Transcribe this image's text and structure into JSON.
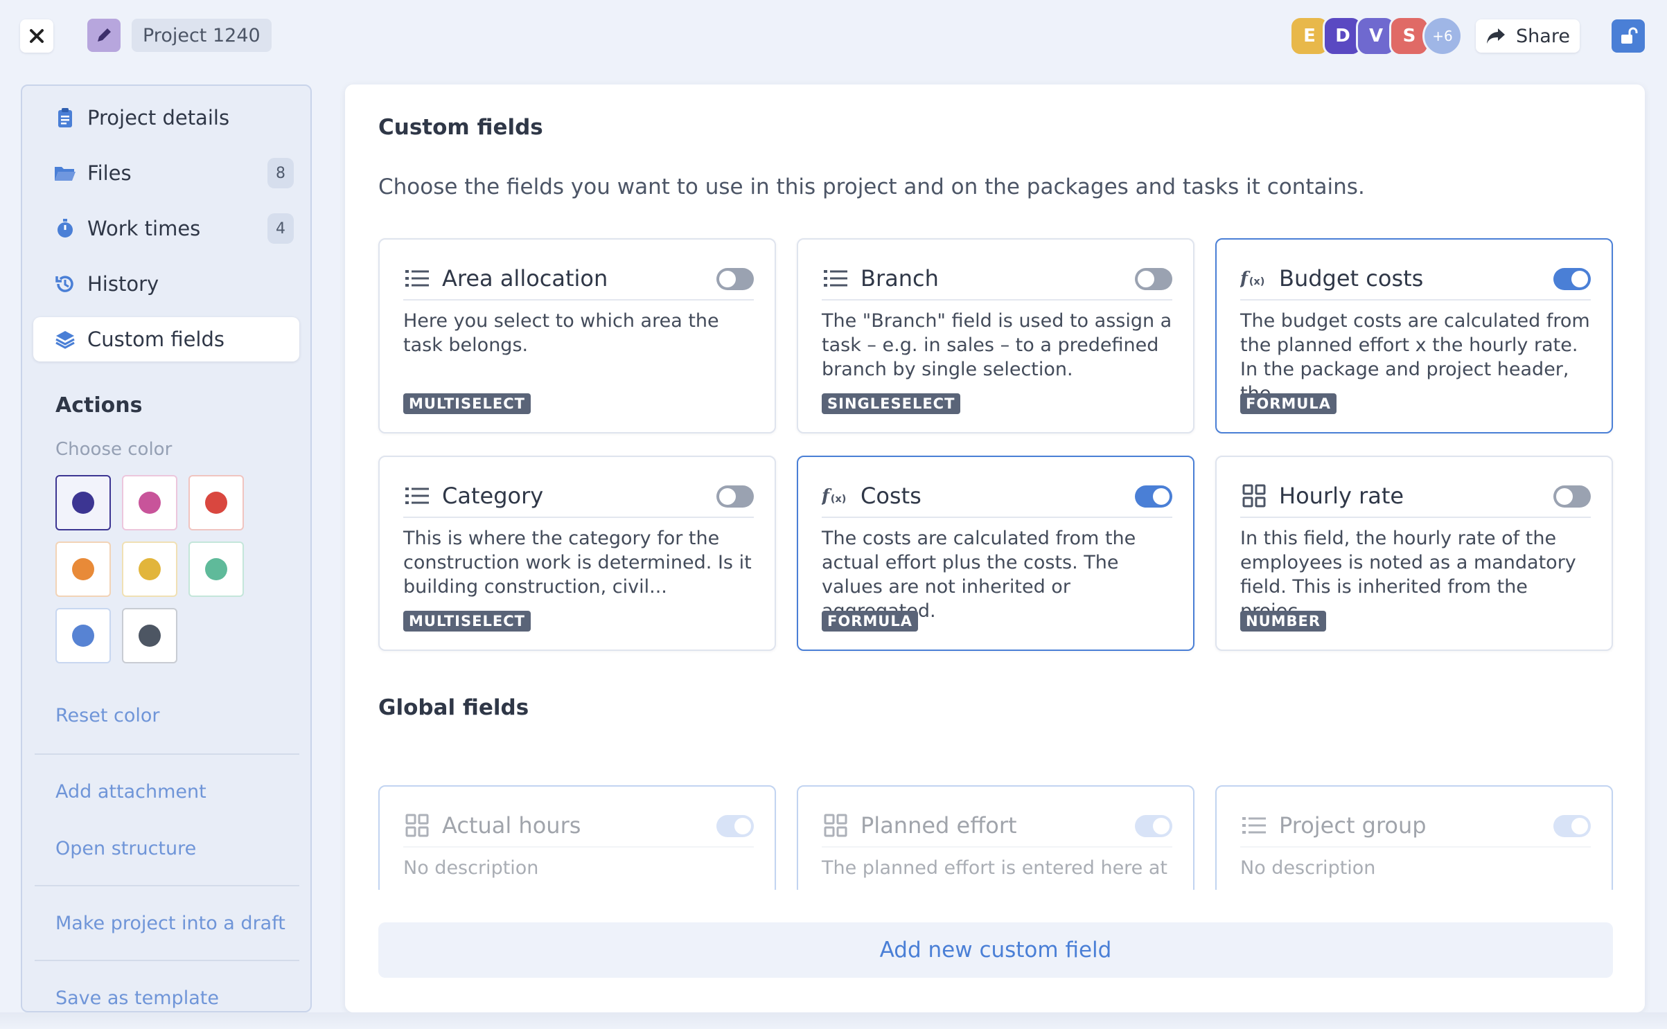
{
  "header": {
    "project_title": "Project 1240",
    "share_label": "Share",
    "avatars": [
      {
        "letter": "E",
        "color": "#e8b84a"
      },
      {
        "letter": "D",
        "color": "#5a49c2"
      },
      {
        "letter": "V",
        "color": "#6f69cf"
      },
      {
        "letter": "S",
        "color": "#e06a66"
      },
      {
        "letter": "+6",
        "color": "#9fb6e6"
      }
    ]
  },
  "sidebar": {
    "items": [
      {
        "label": "Project details"
      },
      {
        "label": "Files",
        "badge": "8"
      },
      {
        "label": "Work times",
        "badge": "4"
      },
      {
        "label": "History"
      },
      {
        "label": "Custom fields"
      }
    ],
    "actions_title": "Actions",
    "choose_color_label": "Choose color",
    "colors": [
      "#3c3592",
      "#c8549a",
      "#d9473f",
      "#e88a38",
      "#e2b53b",
      "#5fba9a",
      "#5783d3",
      "#4d5663"
    ],
    "reset_color": "Reset color",
    "add_attachment": "Add attachment",
    "open_structure": "Open structure",
    "make_draft": "Make project into a draft",
    "save_template": "Save as template"
  },
  "main": {
    "custom_title": "Custom fields",
    "custom_desc": "Choose the fields you want to use in this project and on the packages and tasks it contains.",
    "cards": [
      {
        "title": "Area allocation",
        "desc": "Here you select to which area the task belongs.",
        "tag": "MULTISELECT",
        "icon": "list-icon",
        "on": false
      },
      {
        "title": "Branch",
        "desc": "The \"Branch\" field is used to assign a task – e.g. in sales – to a predefined branch by single selection.",
        "tag": "SINGLESELECT",
        "icon": "list-icon",
        "on": false
      },
      {
        "title": "Budget costs",
        "desc": "The budget costs are calculated from the planned effort x the hourly rate. In the package and project header, the...",
        "tag": "FORMULA",
        "icon": "formula-icon",
        "on": true
      },
      {
        "title": "Category",
        "desc": "This is where the category for the construction work is determined. Is it building construction, civil...",
        "tag": "MULTISELECT",
        "icon": "list-icon",
        "on": false
      },
      {
        "title": "Costs",
        "desc": "The costs are calculated from the actual effort plus the costs. The values are not inherited or aggregated.",
        "tag": "FORMULA",
        "icon": "formula-icon",
        "on": true
      },
      {
        "title": "Hourly rate",
        "desc": "In this field, the hourly rate of the employees is noted as a mandatory field. This is inherited from the projec...",
        "tag": "NUMBER",
        "icon": "number-icon",
        "on": false
      }
    ],
    "global_title": "Global fields",
    "global_cards": [
      {
        "title": "Actual hours",
        "desc": "No description",
        "icon": "number-icon"
      },
      {
        "title": "Planned effort",
        "desc": "The planned effort is entered here at",
        "icon": "number-icon"
      },
      {
        "title": "Project group",
        "desc": "No description",
        "icon": "list-icon"
      }
    ],
    "add_button": "Add new custom field"
  },
  "colors": {
    "accent": "#4a7fd6",
    "tag_bg": "#5a6478"
  }
}
